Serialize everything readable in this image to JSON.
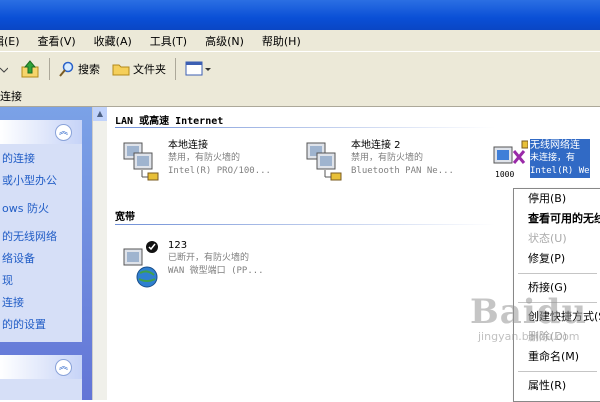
{
  "menu": [
    "查看(V)",
    "收藏(A)",
    "工具(T)",
    "高级(N)",
    "帮助(H)"
  ],
  "menu_partial_first": "编辑(E)",
  "toolbar": {
    "search_label": "搜索",
    "folders_label": "文件夹"
  },
  "address": {
    "text": "连接"
  },
  "left_panel": {
    "items": [
      "的连接",
      "或小型办公",
      "ows 防火",
      "的无线网络",
      "络设备",
      "现",
      "连接",
      "的的设置"
    ]
  },
  "groups": {
    "lan": "LAN 或高速 Internet",
    "broadband": "宽带"
  },
  "connections": [
    {
      "name": "本地连接",
      "status": "禁用，有防火墙的",
      "device": "Intel(R) PRO/100..."
    },
    {
      "name": "本地连接 2",
      "status": "禁用，有防火墙的",
      "device": "Bluetooth PAN Ne..."
    },
    {
      "name": "无线网络连",
      "status": "未连接，有",
      "device": "Intel(R) We",
      "extra": "1000"
    },
    {
      "name": "123",
      "status": "已断开，有防火墙的",
      "device": "WAN 微型端口 (PP..."
    }
  ],
  "context_menu": [
    {
      "label": "停用(B)",
      "state": "normal"
    },
    {
      "label": "查看可用的无线网络",
      "state": "bold"
    },
    {
      "label": "状态(U)",
      "state": "disabled"
    },
    {
      "label": "修复(P)",
      "state": "normal"
    },
    {
      "label": "桥接(G)",
      "state": "normal"
    },
    {
      "label": "创建快捷方式(S)",
      "state": "normal"
    },
    {
      "label": "删除(D)",
      "state": "disabled"
    },
    {
      "label": "重命名(M)",
      "state": "normal"
    },
    {
      "label": "属性(R)",
      "state": "normal"
    }
  ],
  "watermark": {
    "main": "Baidu",
    "sub": "jingyan.baidu.com"
  },
  "colors": {
    "titlebar": "#0a4fd6",
    "chrome": "#ece9d8",
    "link": "#215dc6",
    "selected": "#316ac5"
  }
}
